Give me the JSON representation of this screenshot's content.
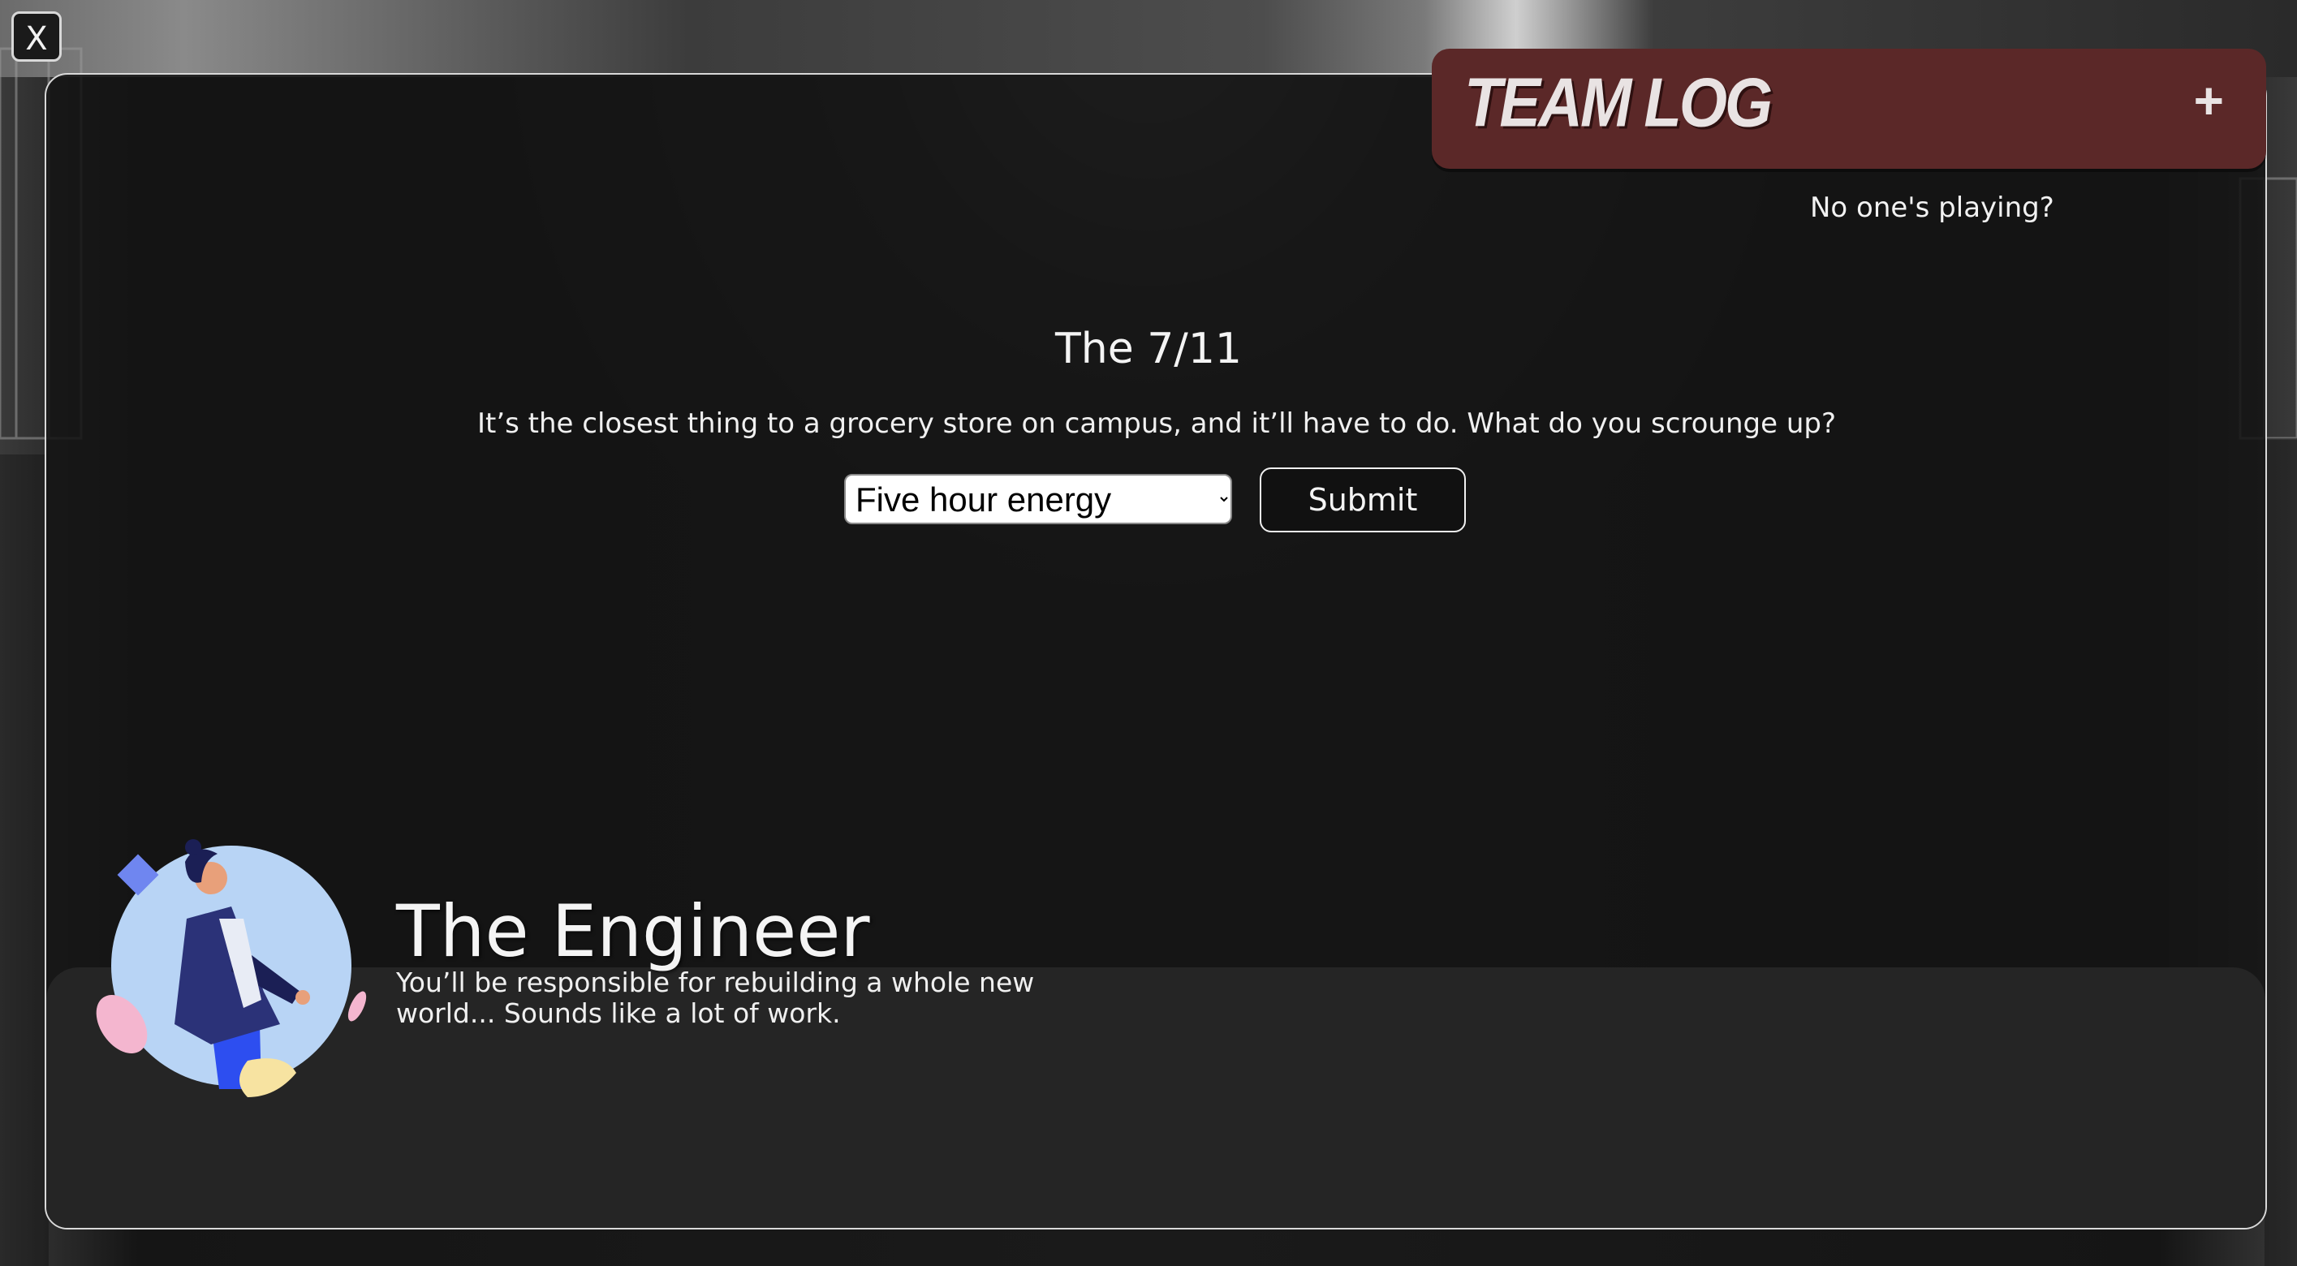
{
  "window": {
    "close_label": "X"
  },
  "team_log": {
    "title": "TEAM LOG",
    "add_label": "+",
    "status": "No one's playing?"
  },
  "scene": {
    "title": "The 7/11",
    "text": "It’s the closest thing to a grocery store on campus, and it’ll have to do. What do you scrounge up?",
    "select": {
      "selected": "Five hour energy",
      "options": [
        "Five hour energy"
      ]
    },
    "submit_label": "Submit"
  },
  "character": {
    "name": "The Engineer",
    "description": "You’ll be responsible for rebuilding a whole new world... Sounds like a lot of work."
  },
  "colors": {
    "team_log_bg": "#5b2828",
    "panel_border": "#d9d9d9",
    "panel_bg": "#141414",
    "avatar_circle": "#b8d4f5",
    "jacket": "#2b3278"
  }
}
